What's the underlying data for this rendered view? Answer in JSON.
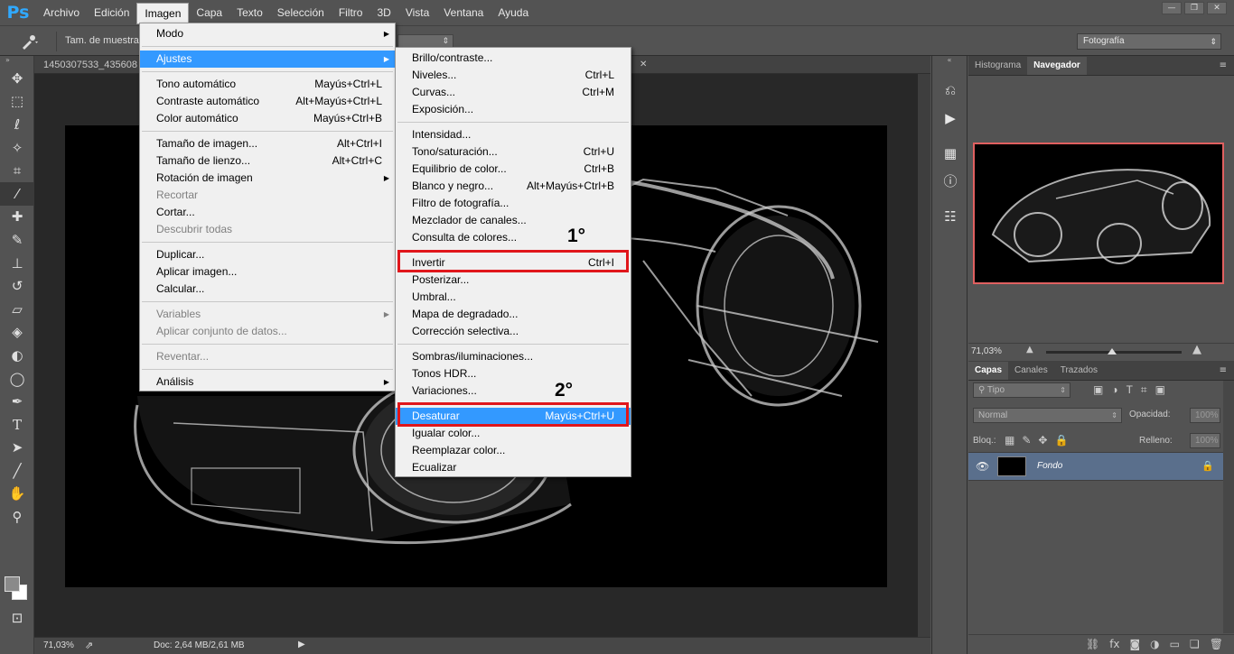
{
  "app": {
    "logo": "Ps",
    "window_buttons": [
      "—",
      "❐",
      "✕"
    ]
  },
  "menubar": [
    "Archivo",
    "Edición",
    "Imagen",
    "Capa",
    "Texto",
    "Selección",
    "Filtro",
    "3D",
    "Vista",
    "Ventana",
    "Ayuda"
  ],
  "options_bar": {
    "sample_label": "Tam. de muestra:",
    "workspace": "Fotografía"
  },
  "document": {
    "tab_title": "1450307533_435608",
    "tab_close": "✕",
    "zoom": "71,03%",
    "doc_info": "Doc: 2,64 MB/2,61 MB"
  },
  "menu_imagen": {
    "sections": [
      [
        {
          "label": "Modo",
          "shortcut": "",
          "submenu": true,
          "disabled": false
        }
      ],
      [
        {
          "label": "Ajustes",
          "shortcut": "",
          "submenu": true,
          "disabled": false,
          "highlight": true
        }
      ],
      [
        {
          "label": "Tono automático",
          "shortcut": "Mayús+Ctrl+L"
        },
        {
          "label": "Contraste automático",
          "shortcut": "Alt+Mayús+Ctrl+L"
        },
        {
          "label": "Color automático",
          "shortcut": "Mayús+Ctrl+B"
        }
      ],
      [
        {
          "label": "Tamaño de imagen...",
          "shortcut": "Alt+Ctrl+I"
        },
        {
          "label": "Tamaño de lienzo...",
          "shortcut": "Alt+Ctrl+C"
        },
        {
          "label": "Rotación de imagen",
          "shortcut": "",
          "submenu": true
        },
        {
          "label": "Recortar",
          "shortcut": "",
          "disabled": true
        },
        {
          "label": "Cortar...",
          "shortcut": ""
        },
        {
          "label": "Descubrir todas",
          "shortcut": "",
          "disabled": true
        }
      ],
      [
        {
          "label": "Duplicar...",
          "shortcut": ""
        },
        {
          "label": "Aplicar imagen...",
          "shortcut": ""
        },
        {
          "label": "Calcular...",
          "shortcut": ""
        }
      ],
      [
        {
          "label": "Variables",
          "shortcut": "",
          "submenu": true,
          "disabled": true
        },
        {
          "label": "Aplicar conjunto de datos...",
          "shortcut": "",
          "disabled": true
        }
      ],
      [
        {
          "label": "Reventar...",
          "shortcut": "",
          "disabled": true
        }
      ],
      [
        {
          "label": "Análisis",
          "shortcut": "",
          "submenu": true
        }
      ]
    ]
  },
  "menu_ajustes": {
    "sections": [
      [
        {
          "label": "Brillo/contraste...",
          "shortcut": ""
        },
        {
          "label": "Niveles...",
          "shortcut": "Ctrl+L"
        },
        {
          "label": "Curvas...",
          "shortcut": "Ctrl+M"
        },
        {
          "label": "Exposición...",
          "shortcut": ""
        }
      ],
      [
        {
          "label": "Intensidad...",
          "shortcut": ""
        },
        {
          "label": "Tono/saturación...",
          "shortcut": "Ctrl+U"
        },
        {
          "label": "Equilibrio de color...",
          "shortcut": "Ctrl+B"
        },
        {
          "label": "Blanco y negro...",
          "shortcut": "Alt+Mayús+Ctrl+B"
        },
        {
          "label": "Filtro de fotografía...",
          "shortcut": ""
        },
        {
          "label": "Mezclador de canales...",
          "shortcut": ""
        },
        {
          "label": "Consulta de colores...",
          "shortcut": ""
        }
      ],
      [
        {
          "label": "Invertir",
          "shortcut": "Ctrl+I"
        },
        {
          "label": "Posterizar...",
          "shortcut": ""
        },
        {
          "label": "Umbral...",
          "shortcut": ""
        },
        {
          "label": "Mapa de degradado...",
          "shortcut": ""
        },
        {
          "label": "Corrección selectiva...",
          "shortcut": ""
        }
      ],
      [
        {
          "label": "Sombras/iluminaciones...",
          "shortcut": ""
        },
        {
          "label": "Tonos HDR...",
          "shortcut": ""
        },
        {
          "label": "Variaciones...",
          "shortcut": ""
        }
      ],
      [
        {
          "label": "Desaturar",
          "shortcut": "Mayús+Ctrl+U",
          "highlight": true
        },
        {
          "label": "Igualar color...",
          "shortcut": ""
        },
        {
          "label": "Reemplazar color...",
          "shortcut": ""
        },
        {
          "label": "Ecualizar",
          "shortcut": ""
        }
      ]
    ]
  },
  "annotations": {
    "step1": "1°",
    "step2": "2°",
    "color": "#e0161b"
  },
  "navigator_panel": {
    "tabs": [
      "Histograma",
      "Navegador"
    ],
    "active_tab": "Navegador",
    "zoom": "71,03%"
  },
  "layers_panel": {
    "tabs": [
      "Capas",
      "Canales",
      "Trazados"
    ],
    "filter": "Tipo",
    "blend_mode": "Normal",
    "opacity_label": "Opacidad:",
    "opacity_value": "100%",
    "lock_label": "Bloq.:",
    "fill_label": "Relleno:",
    "fill_value": "100%",
    "layer_name": "Fondo"
  },
  "accent_color": "#3399ff"
}
